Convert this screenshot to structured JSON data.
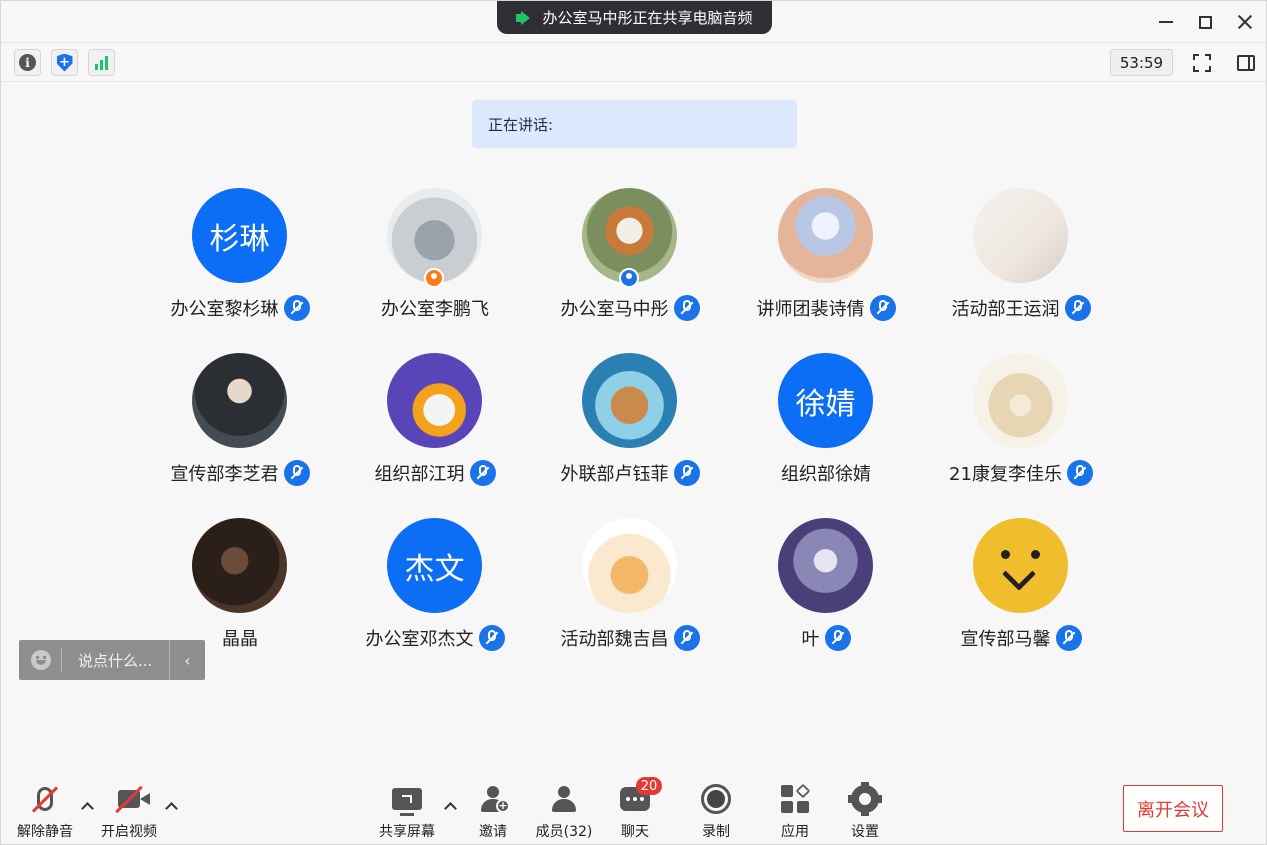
{
  "titlebar": {
    "share_notice": "办公室马中彤正在共享电脑音频",
    "share_icon": "speaker-icon"
  },
  "toolbar": {
    "timer": "53:59",
    "icons": [
      "info-icon",
      "shield-icon",
      "signal-icon",
      "fullscreen-icon",
      "sidebar-icon"
    ]
  },
  "speaking": {
    "label": "正在讲话:"
  },
  "participants": [
    {
      "name": "办公室黎杉琳",
      "avatar_text": "杉琳",
      "muted": true
    },
    {
      "name": "办公室李鹏飞",
      "avatar_text": "",
      "muted": false,
      "role": "host"
    },
    {
      "name": "办公室马中彤",
      "avatar_text": "",
      "muted": true,
      "role": "cohost"
    },
    {
      "name": "讲师团裴诗倩",
      "avatar_text": "",
      "muted": true
    },
    {
      "name": "活动部王运润",
      "avatar_text": "",
      "muted": true
    },
    {
      "name": "宣传部李芝君",
      "avatar_text": "",
      "muted": true
    },
    {
      "name": "组织部江玥",
      "avatar_text": "",
      "muted": true
    },
    {
      "name": "外联部卢钰菲",
      "avatar_text": "",
      "muted": true
    },
    {
      "name": "组织部徐婧",
      "avatar_text": "徐婧",
      "muted": false
    },
    {
      "name": "21康复李佳乐",
      "avatar_text": "",
      "muted": true
    },
    {
      "name": "晶晶",
      "avatar_text": "",
      "muted": false
    },
    {
      "name": "办公室邓杰文",
      "avatar_text": "杰文",
      "muted": true
    },
    {
      "name": "活动部魏吉昌",
      "avatar_text": "",
      "muted": true
    },
    {
      "name": "叶",
      "avatar_text": "",
      "muted": true
    },
    {
      "name": "宣传部马馨",
      "avatar_text": "",
      "muted": true
    }
  ],
  "chat_input": {
    "placeholder": "说点什么..."
  },
  "bottom": {
    "unmute": "解除静音",
    "start_video": "开启视频",
    "share_screen": "共享屏幕",
    "invite": "邀请",
    "members": "成员(32)",
    "chat": "聊天",
    "chat_badge": "20",
    "record": "录制",
    "apps": "应用",
    "settings": "设置",
    "leave": "离开会议"
  },
  "colors": {
    "accent": "#0b6ef5",
    "danger": "#e53935",
    "banner": "#dce8fb"
  }
}
